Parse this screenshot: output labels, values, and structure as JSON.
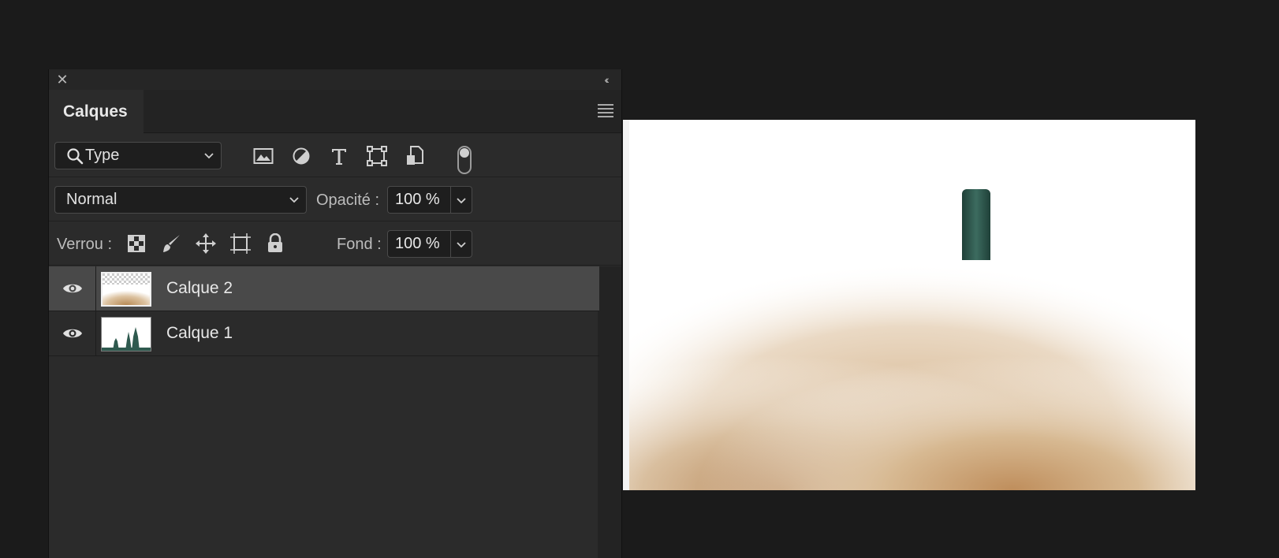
{
  "panel": {
    "close_glyph": "✕",
    "collapse_glyph": "‹‹",
    "tab_title": "Calques",
    "menu_icon": "hamburger-icon"
  },
  "filter": {
    "kind_value": "Type",
    "icons": [
      "image-filter-icon",
      "adjustment-filter-icon",
      "type-filter-icon",
      "shape-filter-icon",
      "smart-object-filter-icon"
    ]
  },
  "blend": {
    "mode_value": "Normal",
    "opacity_label": "Opacité :",
    "opacity_value": "100 %"
  },
  "lock": {
    "label": "Verrou :",
    "icons": [
      "lock-transparent-pixels-icon",
      "lock-image-pixels-icon",
      "lock-position-icon",
      "lock-artboard-icon",
      "lock-all-icon"
    ],
    "fill_label": "Fond :",
    "fill_value": "100 %"
  },
  "layers": [
    {
      "name": "Calque 2",
      "selected": true,
      "visible": true
    },
    {
      "name": "Calque 1",
      "selected": false,
      "visible": true
    }
  ],
  "colors": {
    "panel_bg": "#2b2b2b",
    "app_bg": "#1b1b1b",
    "selected_row": "#494949",
    "bottle_green": "#2f5a4f",
    "sand": "#c9a06c"
  }
}
